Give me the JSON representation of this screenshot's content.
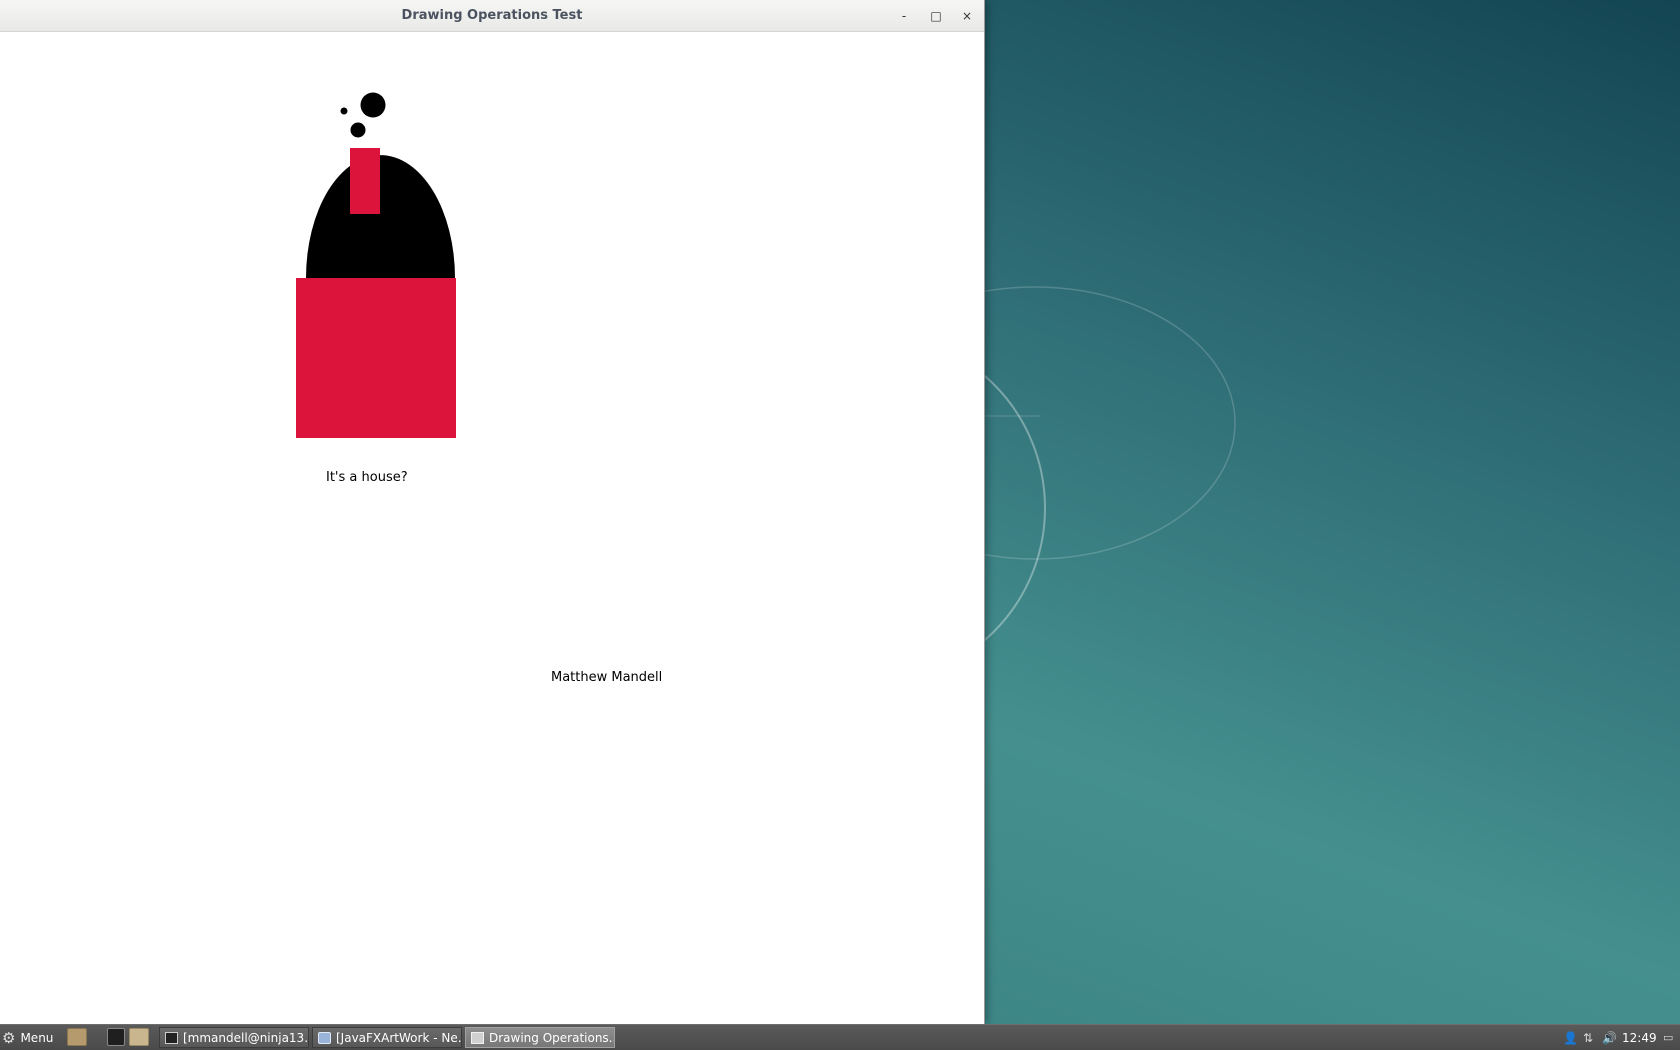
{
  "window": {
    "title": "Drawing Operations Test",
    "controls": {
      "minimize": "-",
      "maximize": "□",
      "close": "×"
    }
  },
  "drawing": {
    "caption": "It's a house?",
    "author": "Matthew Mandell",
    "colors": {
      "wall": "#dc143c",
      "roof": "#000000",
      "chimney": "#dc143c",
      "smoke": "#000000",
      "canvas": "#ffffff"
    }
  },
  "taskbar": {
    "menu_label": "Menu",
    "tasks": [
      {
        "label": "[mmandell@ninja13...",
        "icon": "terminal-icon"
      },
      {
        "label": "[JavaFXArtWork - Ne...",
        "icon": "netbeans-icon"
      },
      {
        "label": "Drawing Operations...",
        "icon": "window-icon",
        "active": true
      }
    ],
    "clock": "12:49"
  },
  "desktop": {
    "colors": {
      "dark": "#134552",
      "mid": "#2d6b74",
      "light": "#45908f"
    }
  }
}
